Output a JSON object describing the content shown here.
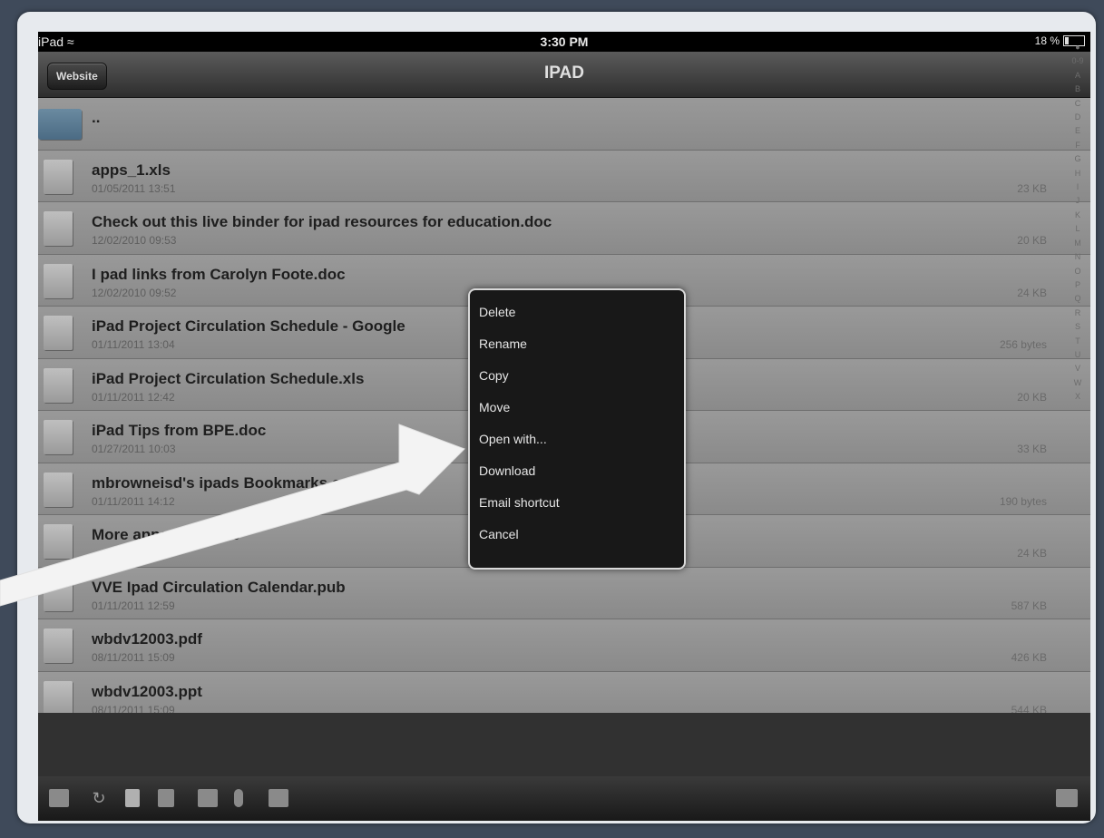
{
  "status": {
    "carrier": "iPad",
    "time": "3:30 PM",
    "battery": "18 %",
    "battery_level": 0.18
  },
  "navbar": {
    "back_label": "Website",
    "title": "IPAD"
  },
  "files": [
    {
      "name": "..",
      "date": "",
      "size": "",
      "icon": "folder-icon"
    },
    {
      "name": "apps_1.xls",
      "date": "01/05/2011 13:51",
      "size": "23 KB",
      "icon": "xls-file-icon"
    },
    {
      "name": "Check out this live binder for ipad resources for education.doc",
      "date": "12/02/2010 09:53",
      "size": "20 KB",
      "icon": "doc-file-icon"
    },
    {
      "name": "I pad links from Carolyn Foote.doc",
      "date": "12/02/2010 09:52",
      "size": "24 KB",
      "icon": "doc-file-icon"
    },
    {
      "name": "iPad Project Circulation Schedule - Google",
      "date": "01/11/2011 13:04",
      "size": "256 bytes",
      "icon": "file-icon"
    },
    {
      "name": "iPad Project Circulation Schedule.xls",
      "date": "01/11/2011 12:42",
      "size": "20 KB",
      "icon": "xls-file-icon"
    },
    {
      "name": "iPad Tips from BPE.doc",
      "date": "01/27/2011 10:03",
      "size": "33 KB",
      "icon": "doc-file-icon"
    },
    {
      "name": "mbrowneisd's ipads Bookmarks on Delicio",
      "date": "01/11/2011 14:12",
      "size": "190 bytes",
      "icon": "file-icon"
    },
    {
      "name": "More apps sites.doc",
      "date": "",
      "size": "24 KB",
      "icon": "doc-file-icon"
    },
    {
      "name": "VVE Ipad Circulation Calendar.pub",
      "date": "01/11/2011 12:59",
      "size": "587 KB",
      "icon": "file-icon"
    },
    {
      "name": "wbdv12003.pdf",
      "date": "08/11/2011 15:09",
      "size": "426 KB",
      "icon": "pdf-file-icon"
    },
    {
      "name": "wbdv12003.ppt",
      "date": "08/11/2011 15:09",
      "size": "544 KB",
      "icon": "file-icon"
    }
  ],
  "index_letters": [
    "●",
    "0-9",
    "A",
    "B",
    "C",
    "D",
    "E",
    "F",
    "G",
    "H",
    "I",
    "J",
    "K",
    "L",
    "M",
    "N",
    "O",
    "P",
    "Q",
    "R",
    "S",
    "T",
    "U",
    "V",
    "W",
    "X"
  ],
  "context_menu": [
    "Delete",
    "Rename",
    "Copy",
    "Move",
    "Open with...",
    "Download",
    "Email shortcut",
    "Cancel"
  ],
  "toolbar_icons": [
    "new-folder-icon",
    "refresh-icon",
    "tablet-icon",
    "pages-icon",
    "camera-icon",
    "microphone-icon",
    "video-icon",
    "export-icon"
  ]
}
